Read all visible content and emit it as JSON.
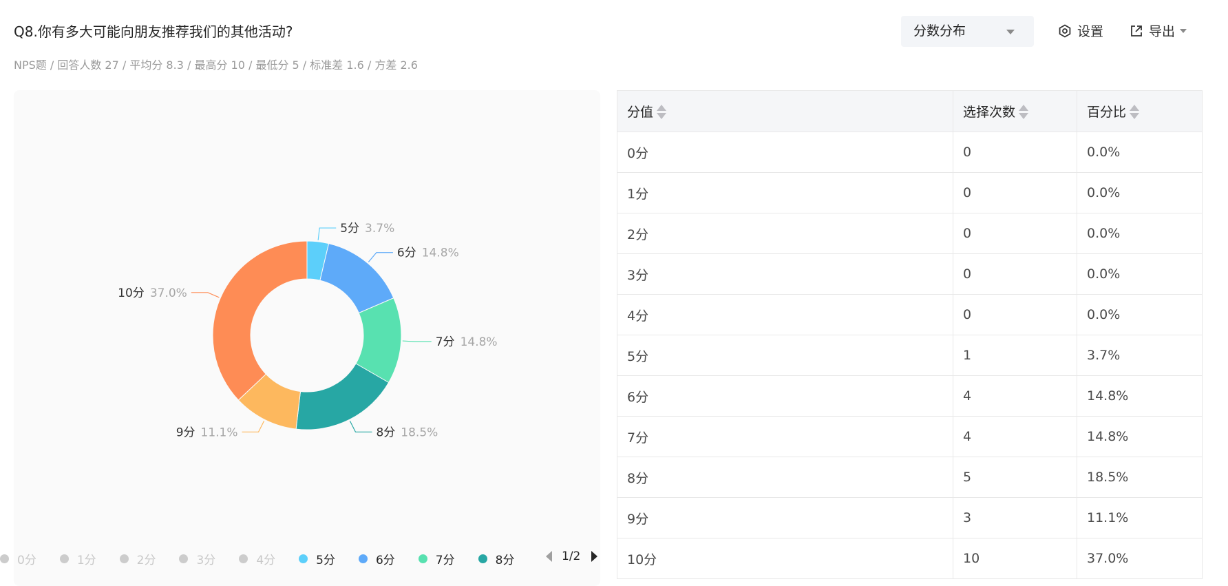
{
  "question_title": "Q8.你有多大可能向朋友推荐我们的其他活动?",
  "stats_line": "NPS题 / 回答人数 27 / 平均分 8.3 / 最高分 10 / 最低分 5 / 标准差 1.6 / 方差 2.6",
  "toolbar": {
    "chart_type_value": "分数分布",
    "settings_label": "设置",
    "export_label": "导出"
  },
  "colors": {
    "5分": "#5ccffa",
    "6分": "#5eaaf9",
    "7分": "#58e1b0",
    "8分": "#27a7a4",
    "9分": "#fdb85e",
    "10分": "#fe8c55",
    "inactive": "#cccccc"
  },
  "chart_data": {
    "type": "pie",
    "donut": true,
    "categories": [
      "0分",
      "1分",
      "2分",
      "3分",
      "4分",
      "5分",
      "6分",
      "7分",
      "8分",
      "9分",
      "10分"
    ],
    "values": [
      0,
      0,
      0,
      0,
      0,
      1,
      4,
      4,
      5,
      3,
      10
    ],
    "percent_labels": [
      "0.0%",
      "0.0%",
      "0.0%",
      "0.0%",
      "0.0%",
      "3.7%",
      "14.8%",
      "14.8%",
      "18.5%",
      "11.1%",
      "37.0%"
    ],
    "legend_visible": [
      "0分",
      "1分",
      "2分",
      "3分",
      "4分",
      "5分",
      "6分",
      "7分",
      "8分"
    ],
    "legend_page": "1/2",
    "legend_position": "bottom"
  },
  "table": {
    "headers": [
      "分值",
      "选择次数",
      "百分比"
    ],
    "rows": [
      [
        "0分",
        "0",
        "0.0%"
      ],
      [
        "1分",
        "0",
        "0.0%"
      ],
      [
        "2分",
        "0",
        "0.0%"
      ],
      [
        "3分",
        "0",
        "0.0%"
      ],
      [
        "4分",
        "0",
        "0.0%"
      ],
      [
        "5分",
        "1",
        "3.7%"
      ],
      [
        "6分",
        "4",
        "14.8%"
      ],
      [
        "7分",
        "4",
        "14.8%"
      ],
      [
        "8分",
        "5",
        "18.5%"
      ],
      [
        "9分",
        "3",
        "11.1%"
      ],
      [
        "10分",
        "10",
        "37.0%"
      ]
    ]
  }
}
